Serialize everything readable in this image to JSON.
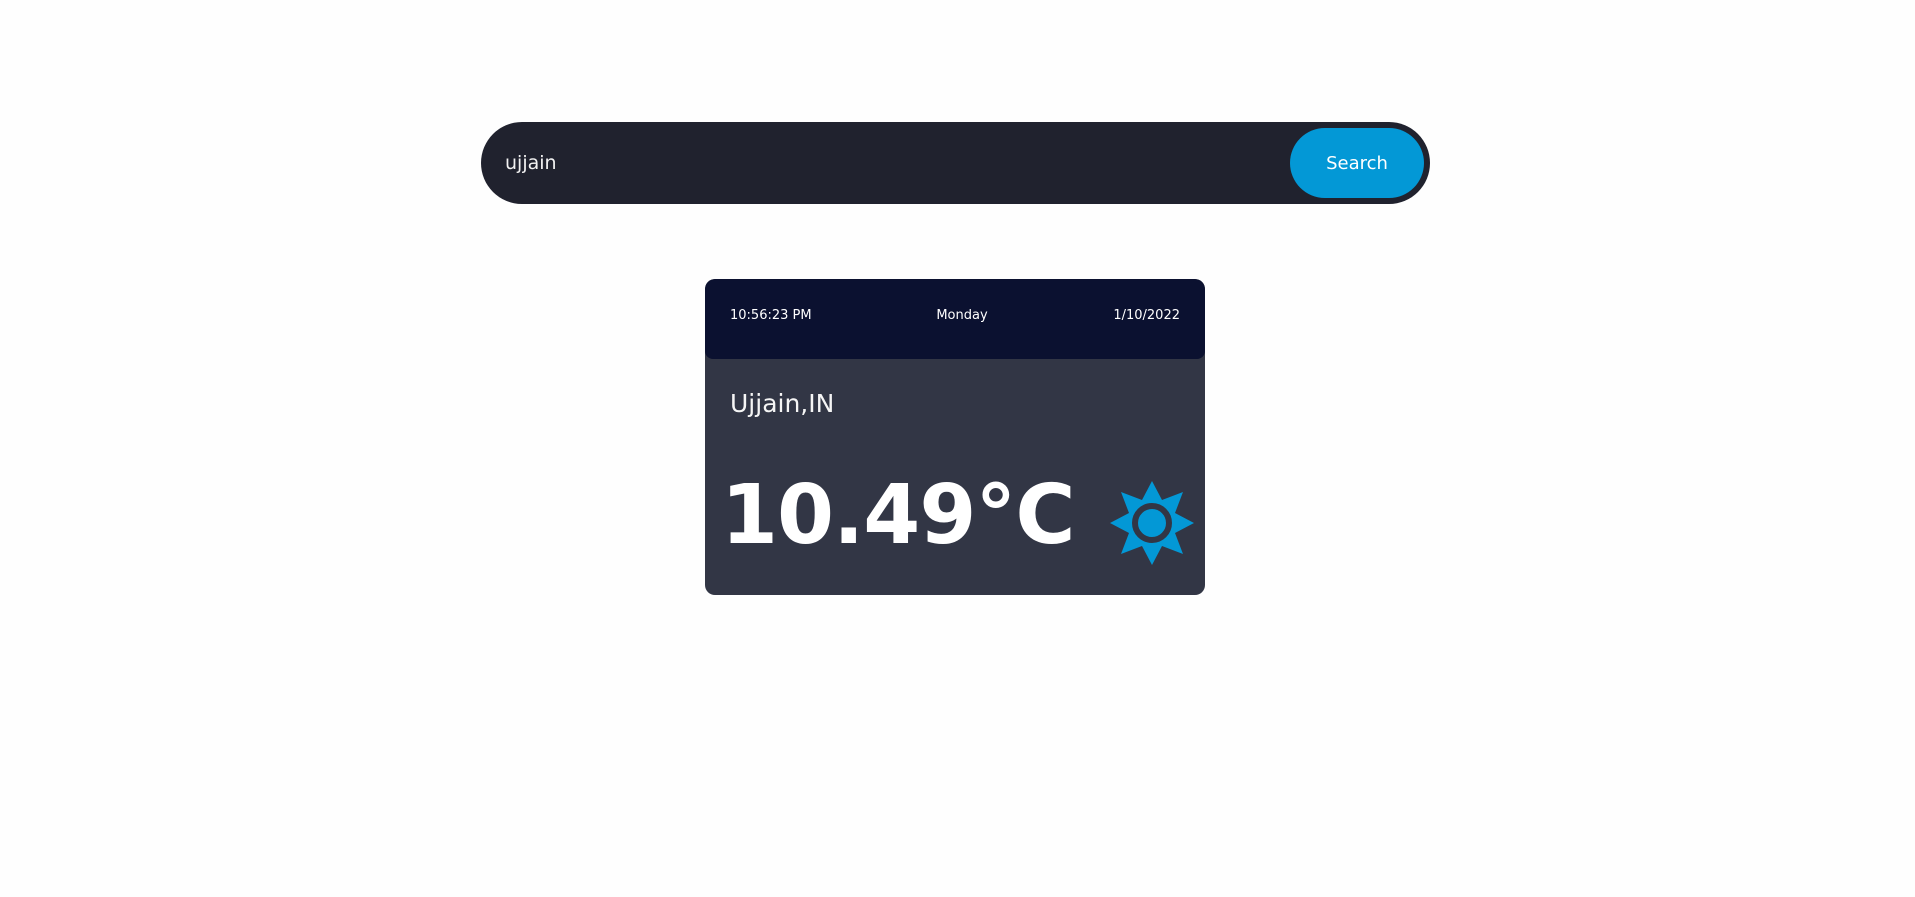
{
  "search": {
    "value": "ujjain",
    "button_label": "Search"
  },
  "weather_card": {
    "time": "10:56:23 PM",
    "day": "Monday",
    "date": "1/10/2022",
    "location": "Ujjain,IN",
    "temperature": "10.49°C",
    "condition_icon": "sun-icon"
  },
  "colors": {
    "search_bar_bg": "#20222e",
    "accent": "#0398d6",
    "card_bg": "#323645",
    "card_header_bg": "#0b1130"
  }
}
